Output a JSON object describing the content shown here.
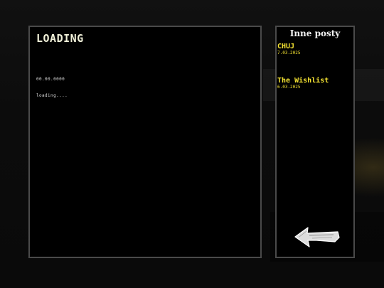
{
  "main": {
    "title": "LOADING",
    "date": "00.00.0000",
    "status": "loading...."
  },
  "sidebar": {
    "title": "Inne posty",
    "posts": [
      {
        "title": "CHUJ",
        "date": "7.03.2025"
      },
      {
        "title": "The Wishlist",
        "date": "6.03.2025"
      }
    ]
  },
  "icons": {
    "back": "back-arrow-icon"
  },
  "colors": {
    "post_link": "#f4e232",
    "panel_border": "#4a4a4a",
    "background": "#000000"
  }
}
